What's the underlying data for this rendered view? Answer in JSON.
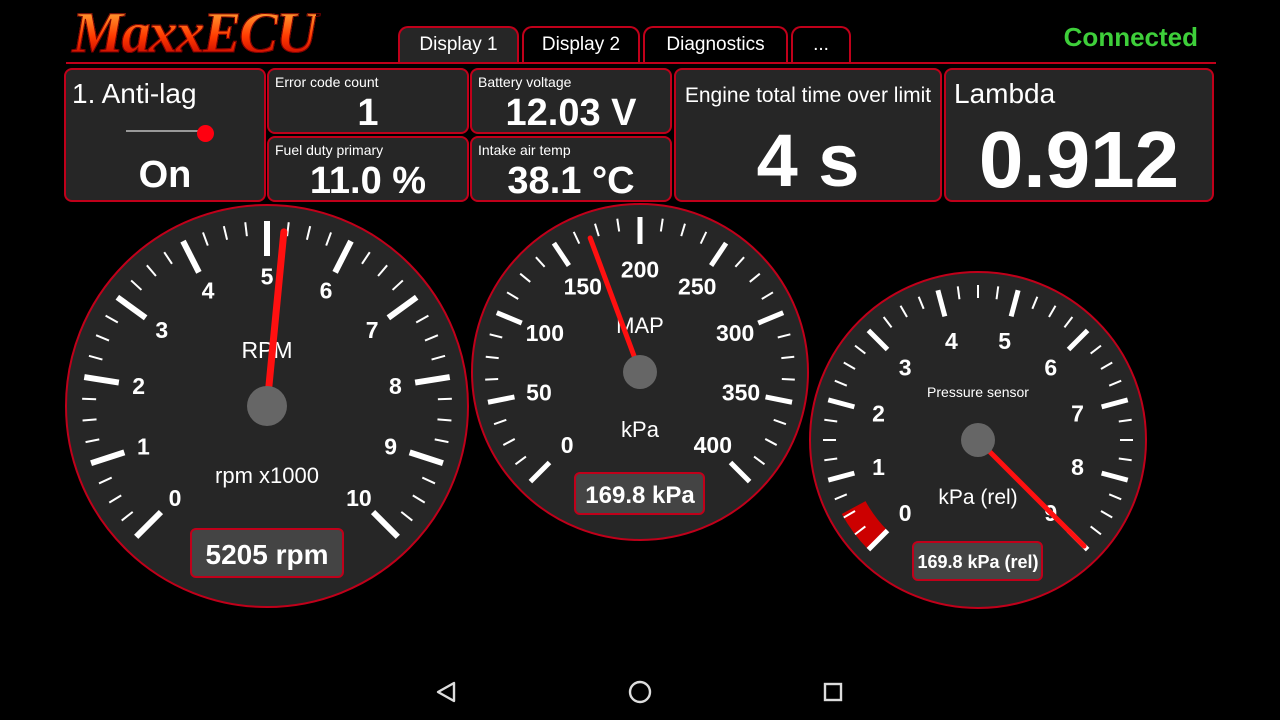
{
  "app": {
    "logo": "MaxxECU",
    "status": "Connected"
  },
  "tabs": [
    {
      "label": "Display 1",
      "active": true
    },
    {
      "label": "Display 2",
      "active": false
    },
    {
      "label": "Diagnostics",
      "active": false
    },
    {
      "label": "...",
      "active": false
    }
  ],
  "tiles": {
    "antilag": {
      "label": "1. Anti-lag",
      "state": "On"
    },
    "error_count": {
      "label": "Error code count",
      "value": "1"
    },
    "battery": {
      "label": "Battery voltage",
      "value": "12.03 V"
    },
    "fuel_duty": {
      "label": "Fuel duty primary",
      "value": "11.0 %"
    },
    "intake_temp": {
      "label": "Intake air temp",
      "value": "38.1 °C"
    },
    "time_over_limit": {
      "label": "Engine total time over limit",
      "value": "4 s"
    },
    "lambda": {
      "label": "Lambda",
      "value": "0.912"
    }
  },
  "gauges": {
    "rpm": {
      "title": "RPM",
      "unit": "rpm x1000",
      "readout": "5205 rpm",
      "min": 0,
      "max": 10,
      "value": 5.205,
      "labels": [
        "0",
        "1",
        "2",
        "3",
        "4",
        "5",
        "6",
        "7",
        "8",
        "9",
        "10"
      ]
    },
    "map": {
      "title": "MAP",
      "unit": "kPa",
      "readout": "169.8 kPa",
      "min": 0,
      "max": 400,
      "value": 169.8,
      "labels": [
        "0",
        "50",
        "100",
        "150",
        "200",
        "250",
        "300",
        "350",
        "400"
      ]
    },
    "pressure": {
      "title": "Pressure sensor",
      "unit": "kPa (rel)",
      "readout": "169.8 kPa (rel)",
      "min": 0,
      "max": 9,
      "value": 9.0,
      "labels": [
        "0",
        "1",
        "2",
        "3",
        "4",
        "5",
        "6",
        "7",
        "8",
        "9"
      ]
    }
  },
  "colors": {
    "accent": "#c0001a",
    "needle": "#ff1010",
    "connected": "#3ecf3a",
    "panel": "#262626"
  },
  "navbar": {
    "icons": [
      "back-triangle-icon",
      "home-circle-icon",
      "recents-square-icon"
    ]
  }
}
